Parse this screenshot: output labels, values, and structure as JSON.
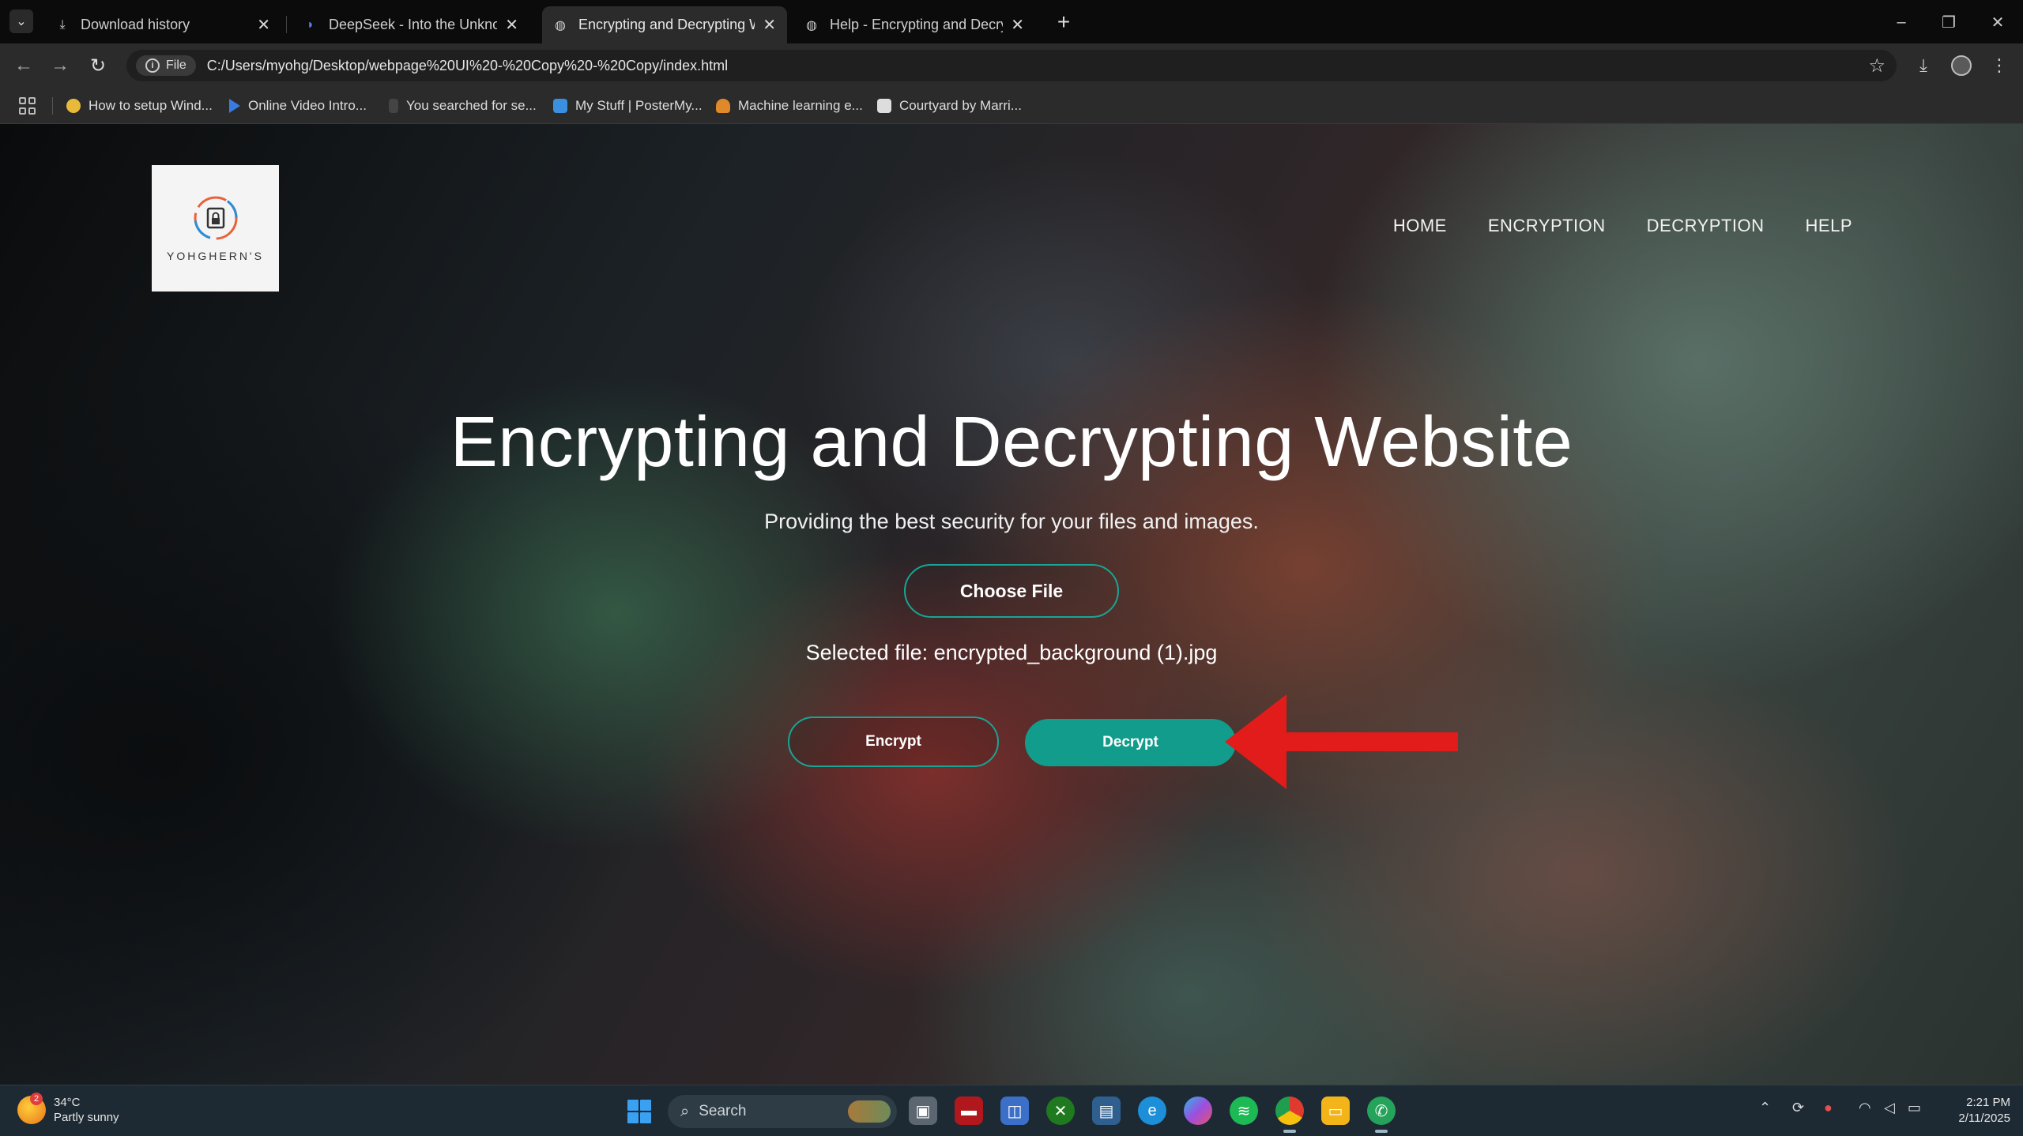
{
  "browser": {
    "tabs": [
      {
        "title": "Download history",
        "icon": "download-icon",
        "active": false
      },
      {
        "title": "DeepSeek - Into the Unknown",
        "icon": "deepseek-icon",
        "active": false
      },
      {
        "title": "Encrypting and Decrypting Wel",
        "icon": "globe-icon",
        "active": true
      },
      {
        "title": "Help - Encrypting and Decrypti",
        "icon": "globe-icon",
        "active": false
      }
    ],
    "chip_label": "File",
    "url": "C:/Users/myohg/Desktop/webpage%20UI%20-%20Copy%20-%20Copy/index.html",
    "bookmarks": [
      {
        "label": "How to setup Wind...",
        "color": "#e9b93a"
      },
      {
        "label": "Online Video Intro...",
        "color": "#3a7be0"
      },
      {
        "label": "You searched for se...",
        "color": "#444444"
      },
      {
        "label": "My Stuff | PosterMy...",
        "color": "#3a8fe0"
      },
      {
        "label": "Machine learning e...",
        "color": "#e0892a"
      },
      {
        "label": "Courtyard by Marri...",
        "color": "#dddddd"
      }
    ]
  },
  "site": {
    "logo_text": "YOHGHERN'S",
    "nav": [
      "HOME",
      "ENCRYPTION",
      "DECRYPTION",
      "HELP"
    ],
    "title": "Encrypting and Decrypting Website",
    "subtitle": "Providing the best security for your files and images.",
    "choose_file_label": "Choose File",
    "selected_file": "Selected file: encrypted_background (1).jpg",
    "encrypt_label": "Encrypt",
    "decrypt_label": "Decrypt",
    "accent_color": "#129c8b",
    "annotation_arrow_color": "#e21b1b"
  },
  "taskbar": {
    "temperature": "34°C",
    "weather": "Partly sunny",
    "weather_badge": "2",
    "search_placeholder": "Search",
    "time": "2:21 PM",
    "date": "2/11/2025"
  }
}
